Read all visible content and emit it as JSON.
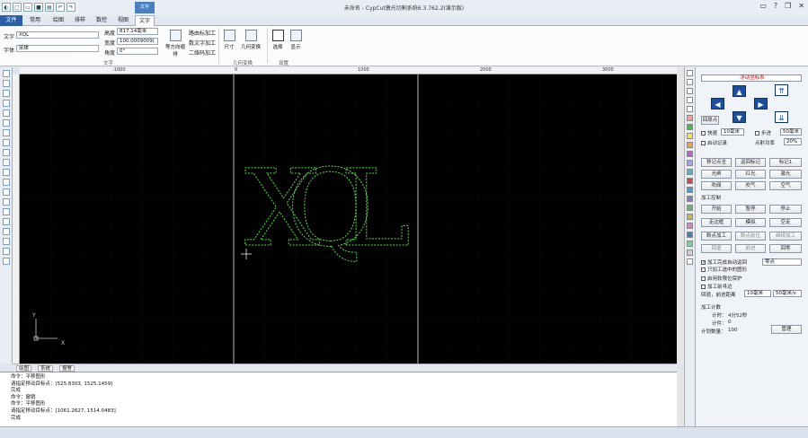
{
  "app": {
    "title": "未命名 - CypCut激光切割系统6.3.762.2(演示版)",
    "context_tab": "文字"
  },
  "ribbon": {
    "tabs": [
      "文件",
      "常用",
      "绘图",
      "排样",
      "数控",
      "视图",
      "文字"
    ],
    "text_label": "文字",
    "text_value": "XQL",
    "font_label": "字体",
    "font_value": "宋体",
    "height_label": "高度",
    "height_value": "817.14毫米",
    "width_label": "宽度",
    "width_value": "100.0009009(",
    "angle_label": "角度",
    "angle_value": "0°",
    "equal_spacing": "等方向缩排",
    "process_text": "路由标加工",
    "process_text2": "数文字加工",
    "process_text3": "二维码加工",
    "group_text": "文字",
    "size_btn": "尺寸",
    "transform_btn": "几何变换",
    "group_geometry": "几何变换",
    "select_btn": "选择",
    "show_btn": "显示",
    "group_settings": "设置"
  },
  "ruler": {
    "h_ticks": [
      "-1000",
      "0",
      "1000",
      "2000",
      "3000"
    ]
  },
  "canvas": {
    "text": "XQL",
    "axis_y": "Y",
    "axis_x": "X"
  },
  "panel": {
    "coord_select": "浮动坐标系",
    "home_btn": "回原点",
    "fast_label": "快速",
    "fast_value": "10毫米",
    "step_label": "步进",
    "step_value": "50毫米",
    "start_label": "启动记录",
    "point_label": "点射功率",
    "point_value": "20%",
    "mark_btn": "移记点坐",
    "return_btn": "返回标记",
    "mark2_btn": "标记1",
    "laser_btn": "光闸",
    "red_btn": "红光",
    "shutter_btn": "激光",
    "blow_btn": "吹阀",
    "air_btn": "吹气",
    "gas_btn": "空气",
    "process_control": "加工控制",
    "start_btn": "开始",
    "pause_btn": "暂停",
    "stop_btn": "停止",
    "frame_btn": "走边框",
    "sim_btn": "模拟",
    "dry_btn": "空走",
    "breakpoint_btn": "断点加工",
    "prev_btn": "断点前位",
    "next_btn": "继续加工",
    "back_btn": "回退",
    "fwd_btn": "前进",
    "reset_btn": "回零",
    "auto_return": "加工完成自动返回",
    "return_target": "零点",
    "only_selected": "只加工选中的图形",
    "soft_limit": "启用软限位保护",
    "loop_process": "加工前寻边",
    "backfwd_label": "回退，前进距离",
    "backfwd_value": "10毫米",
    "speed_value": "50毫米/s",
    "counter_title": "加工计数",
    "time_label": "计时：",
    "time_value": "4分52秒",
    "count_label": "计件：",
    "count_value": "0",
    "plan_label": "计划数量：",
    "plan_value": "100",
    "manage_btn": "管理"
  },
  "doc_tabs": [
    "绘图",
    "系统",
    "报警"
  ],
  "console": {
    "lines": [
      "命令：平移图形",
      "请指定移动目标点：[525.8303, 1525.1459]",
      "完成",
      "命令：撤销",
      "命令：平移图形",
      "请指定移动目标点：[1061.2627, 1514.0483]",
      "完成"
    ]
  },
  "colors": {
    "accent": "#2b5ea8",
    "canvas_bg": "#000000",
    "path_green": "#5ad84a",
    "arrow_blue": "#1c4f9c"
  }
}
